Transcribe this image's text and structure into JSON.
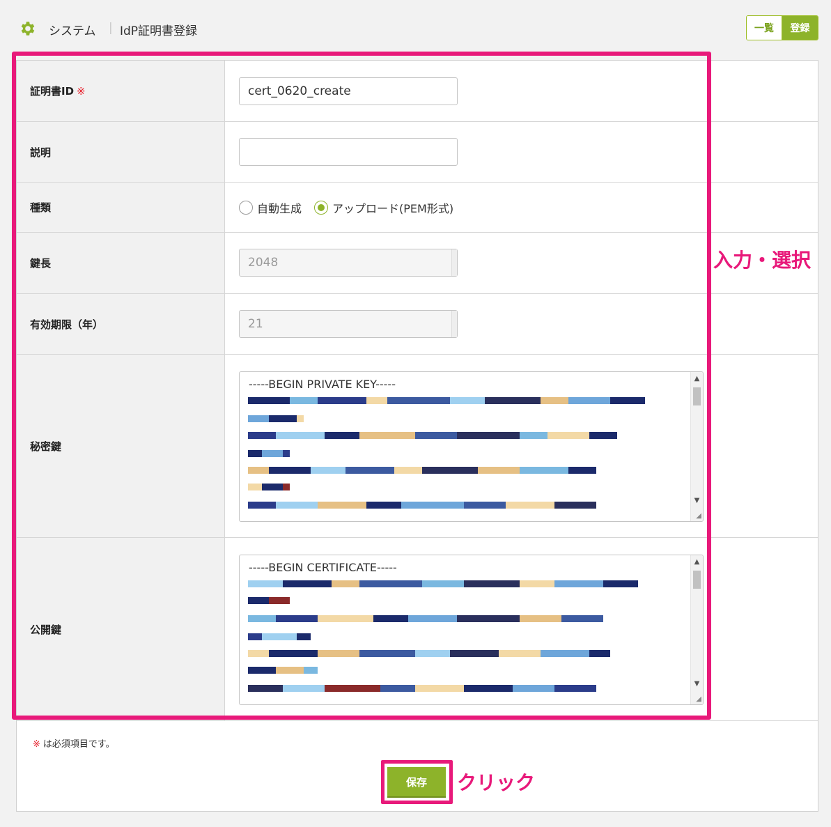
{
  "header": {
    "section": "システム",
    "separator": "|",
    "page_title": "IdP証明書登録",
    "list_button": "一覧",
    "register_button": "登録"
  },
  "form": {
    "cert_id": {
      "label": "証明書ID",
      "required_mark": "※",
      "value": "cert_0620_create"
    },
    "description": {
      "label": "説明",
      "value": ""
    },
    "type": {
      "label": "種類",
      "options": [
        {
          "label": "自動生成",
          "selected": false
        },
        {
          "label": "アップロード(PEM形式)",
          "selected": true
        }
      ]
    },
    "key_length": {
      "label": "鍵長",
      "value": "2048"
    },
    "validity": {
      "label": "有効期限（年）",
      "value": "21"
    },
    "private_key": {
      "label": "秘密鍵",
      "first_line": "-----BEGIN PRIVATE KEY-----"
    },
    "public_key": {
      "label": "公開鍵",
      "first_line": "-----BEGIN CERTIFICATE-----"
    }
  },
  "footer": {
    "required_note_mark": "※",
    "required_note": "は必須項目です。",
    "save_button": "保存"
  },
  "annotations": {
    "input_select": "入力・選択",
    "click": "クリック"
  },
  "colors": {
    "accent_green": "#8db32a",
    "highlight_pink": "#e8197a",
    "required_red": "#e8222e"
  }
}
